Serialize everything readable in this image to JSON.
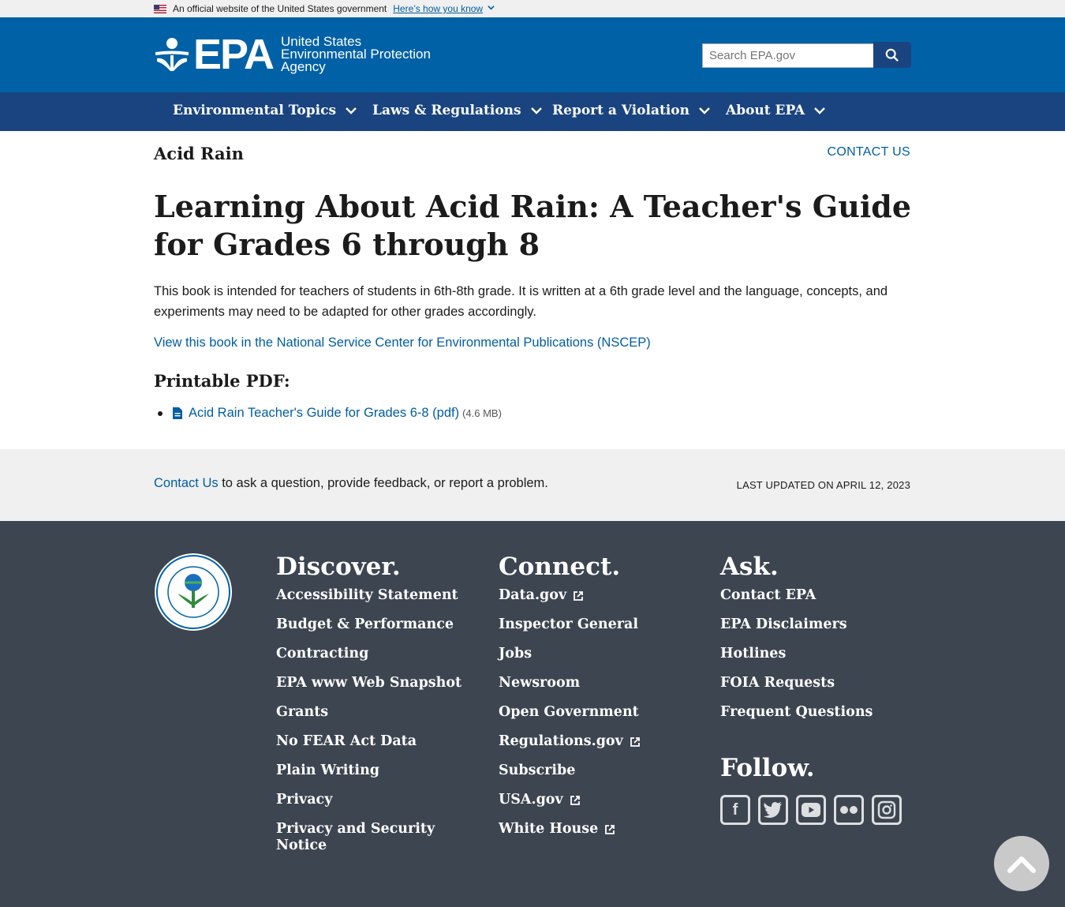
{
  "gov_banner": {
    "text": "An official website of the United States government",
    "link": "Here’s how you know"
  },
  "header": {
    "logo_abbrev": "EPA",
    "logo_line1": "United States",
    "logo_line2": "Environmental Protection",
    "logo_line3": "Agency",
    "search_placeholder": "Search EPA.gov",
    "brand_color": "#0061a6",
    "nav_color": "#1a4480"
  },
  "nav": {
    "items": [
      {
        "label": "Environmental Topics"
      },
      {
        "label": "Laws & Regulations"
      },
      {
        "label": "Report a Violation"
      },
      {
        "label": "About EPA"
      }
    ]
  },
  "page": {
    "section": "Acid Rain",
    "contact_top": "CONTACT US",
    "title": "Learning About Acid Rain: A Teacher's Guide for Grades 6 through 8",
    "intro": "This book is intended for teachers of students in 6th-8th grade.  It is written at a 6th grade level and the language, concepts, and experiments may need to be adapted for other grades accordingly.",
    "nscep_link": "View this book in the National Service Center for Environmental Publications (NSCEP)",
    "pdf_heading": "Printable PDF:",
    "pdf_link": "Acid Rain Teacher's Guide for Grades 6-8 (pdf)",
    "pdf_size": "(4.6 MB)"
  },
  "feedback": {
    "link": "Contact Us",
    "text": " to ask a question, provide feedback, or report a problem.",
    "updated": "LAST UPDATED ON APRIL 12, 2023"
  },
  "footer": {
    "discover": {
      "heading": "Discover.",
      "items": [
        "Accessibility Statement",
        "Budget & Performance",
        "Contracting",
        "EPA www Web Snapshot",
        "Grants",
        "No FEAR Act Data",
        "Plain Writing",
        "Privacy",
        "Privacy and Security Notice"
      ]
    },
    "connect": {
      "heading": "Connect.",
      "items": [
        "Data.gov",
        "Inspector General",
        "Jobs",
        "Newsroom",
        "Open Government",
        "Regulations.gov",
        "Subscribe",
        "USA.gov",
        "White House"
      ]
    },
    "ask": {
      "heading": "Ask.",
      "items": [
        "Contact EPA",
        "EPA Disclaimers",
        "Hotlines",
        "FOIA Requests",
        "Frequent Questions"
      ]
    },
    "follow": {
      "heading": "Follow.",
      "icons": [
        "facebook-icon",
        "twitter-icon",
        "youtube-icon",
        "flickr-icon",
        "instagram-icon"
      ]
    },
    "bg_color": "#3d4551"
  }
}
